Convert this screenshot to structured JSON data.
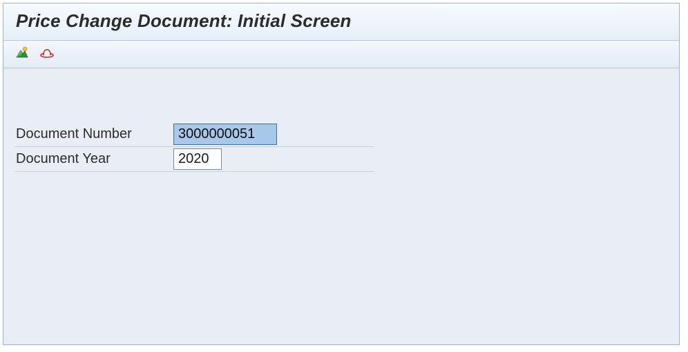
{
  "header": {
    "title": "Price Change Document: Initial Screen"
  },
  "toolbar": {
    "icons": {
      "mountain": "accounting-documents-icon",
      "hat": "original-document-icon"
    }
  },
  "form": {
    "document_number": {
      "label": "Document Number",
      "value": "3000000051"
    },
    "document_year": {
      "label": "Document Year",
      "value": "2020"
    }
  }
}
